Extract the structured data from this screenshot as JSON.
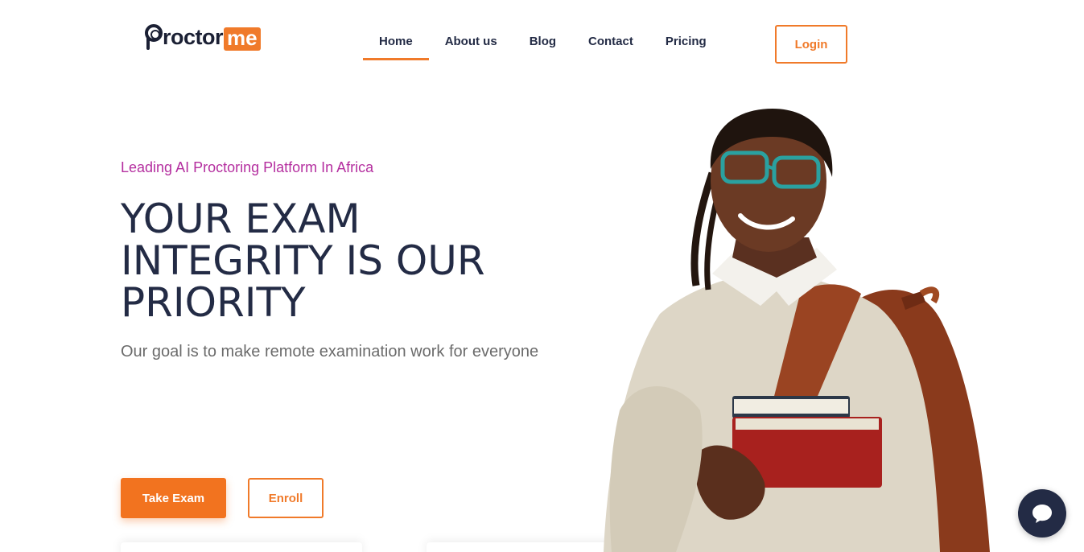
{
  "brand": {
    "name_main": "roctor",
    "name_accent": "me",
    "accent_color": "#f07a2a",
    "dark_color": "#232b45"
  },
  "nav": {
    "items": [
      {
        "label": "Home",
        "active": true
      },
      {
        "label": "About us",
        "active": false
      },
      {
        "label": "Blog",
        "active": false
      },
      {
        "label": "Contact",
        "active": false
      },
      {
        "label": "Pricing",
        "active": false
      }
    ],
    "login_label": "Login"
  },
  "hero": {
    "tagline": "Leading AI Proctoring Platform In Africa",
    "headline": "YOUR EXAM INTEGRITY IS OUR PRIORITY",
    "subtext": "Our goal is to make remote examination work for everyone",
    "primary_button": "Take Exam",
    "secondary_button": "Enroll",
    "tagline_color": "#b42e9f"
  },
  "icons": {
    "chat": "chat-bubble-icon",
    "logo": "proctor-eye-icon"
  }
}
